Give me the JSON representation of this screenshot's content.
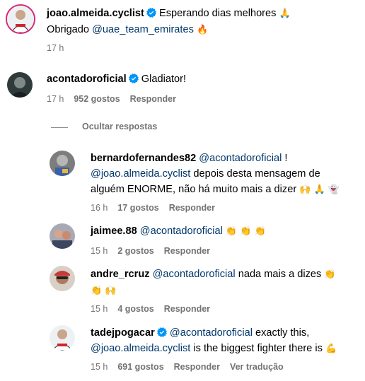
{
  "comments": [
    {
      "username": "joao.almeida.cyclist",
      "text_parts": [
        "Esperando dias melhores",
        "🙏"
      ],
      "line2_prefix": "Obrigado ",
      "line2_mention": "@uae_team_emirates",
      "line2_emoji": "🔥",
      "time": "17 h"
    },
    {
      "username": "acontadoroficial",
      "text": "Gladiator!",
      "time": "17 h",
      "likes": "952 gostos",
      "reply": "Responder"
    }
  ],
  "hide_replies": "Ocultar respostas",
  "replies": [
    {
      "username": "bernardofernandes82",
      "mention1": "@acontadoroficial",
      "after1": " !",
      "mention2": "@joao.almeida.cyclist",
      "after2": " depois desta mensagem de",
      "line3": "alguém ENORME, não há muito mais a dizer",
      "emojis": "🙌 🙏 👻",
      "time": "16 h",
      "likes": "17 gostos",
      "reply": "Responder"
    },
    {
      "username": "jaimee.88",
      "mention": "@acontadoroficial",
      "emojis": "👏 👏 👏",
      "time": "15 h",
      "likes": "2 gostos",
      "reply": "Responder"
    },
    {
      "username": "andre_rcruz",
      "mention": "@acontadoroficial",
      "after": " nada mais a dizes",
      "emoji_end": "👏",
      "line2_emojis": "👏 🙌",
      "time": "15 h",
      "likes": "4 gostos",
      "reply": "Responder"
    },
    {
      "username": "tadejpogacar",
      "mention1": "@acontadoroficial",
      "after1": " exactly this,",
      "mention2": "@joao.almeida.cyclist",
      "after2": " is the biggest fighter there is",
      "emoji": "💪",
      "time": "15 h",
      "likes": "691 gostos",
      "reply": "Responder",
      "translate": "Ver tradução"
    }
  ],
  "colors": {
    "verified": "#0095f6",
    "mention": "#00376b",
    "meta": "#737373"
  }
}
